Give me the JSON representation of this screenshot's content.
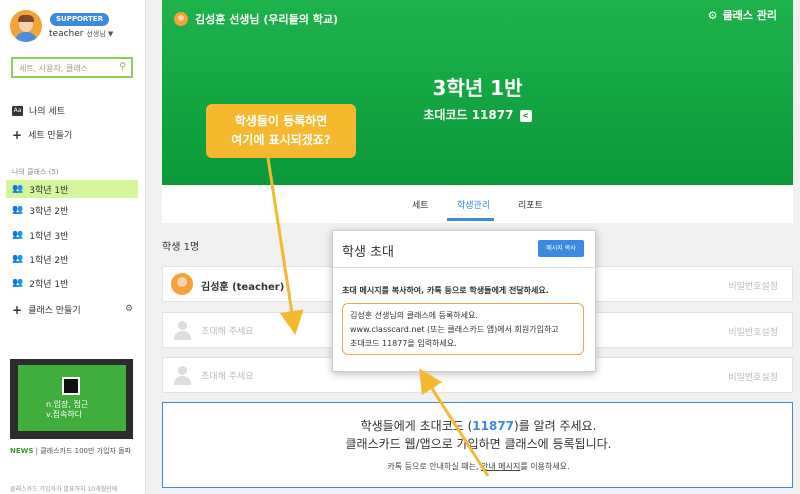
{
  "sidebar": {
    "badge": "SUPPORTER",
    "username": "teacher",
    "username_suffix": "선생님 ▼",
    "search_placeholder": "세트, 사용자, 클래스",
    "my_sets": "나의 세트",
    "make_set": "세트 만들기",
    "my_classes_label": "나의 클래스 (5)",
    "classes": [
      "3학년 1반",
      "3학년 2반",
      "1학년 3반",
      "1학년 2반",
      "2학년 1반"
    ],
    "make_class": "클래스 만들기",
    "promo_line1": "n.입장, 접근",
    "promo_line2": "v.접속하다",
    "news_tag": "NEWS",
    "news_text": " | 클래스카드 100만 가입자 돌파",
    "news_more": "클래스카드 가입자가 발표하지 10개월만에"
  },
  "header": {
    "teacher": "김성훈 선생님  (우리들의 학교)",
    "manage": "클래스 관리",
    "class_name": "3학년 1반",
    "class_code": "초대코드 11877"
  },
  "tabs": [
    "세트",
    "학생관리",
    "리포트"
  ],
  "students": {
    "count": "학생 1명",
    "rows": [
      {
        "name": "김성훈 (teacher)",
        "pw": "비밀번호설정"
      },
      {
        "name": "초대해 주세요",
        "pw": "비밀번호설정"
      },
      {
        "name": "초대해 주세요",
        "pw": "비밀번호설정"
      }
    ]
  },
  "invite_panel": {
    "l1_pre": "학생들에게 초대코드 (",
    "l1_code": "11877",
    "l1_post": ")를 알려 주세요.",
    "l2": "클래스카드 웹/앱으로 가입하면 클래스에 등록됩니다.",
    "l3_pre": "카톡 등으로 안내하실 때는, ",
    "l3_link": "안내 메시지",
    "l3_post": "를 이용하세요."
  },
  "popup": {
    "title": "학생 초대",
    "copy_btn": "메시지 복사",
    "instruction": "초대 메시지를 복사하여, 카톡 등으로 학생들에게 전달하세요.",
    "msg1": "김성훈 선생님의 클래스에 등록하세요.",
    "msg2": "www.classcard.net (또는 클래스카드 앱)에서 회원가입하고",
    "msg3": "초대코드 11877을 입력하세요."
  },
  "tooltip": {
    "line1": "학생들이 등록하면",
    "line2": "여기에  표시되겠죠?"
  },
  "colors": {
    "green": "#0a9a3a",
    "blue": "#3b8ae0",
    "tooltip": "#f5b82e",
    "active_class": "#d4f59c"
  }
}
